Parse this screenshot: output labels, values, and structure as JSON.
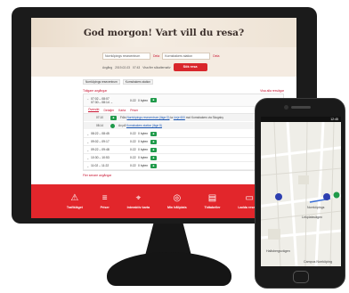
{
  "hero": {
    "title": "God morgon! Vart vill du resa?"
  },
  "search": {
    "from_value": "Norrköpings resecentrum",
    "from_tag": "Dela",
    "to_value": "Kornsbakers station",
    "to_tag": "Dela",
    "options": [
      "Avgång",
      "2019-02-03",
      "07:43",
      "Visa fler sökalternativ"
    ],
    "button": "Sök resa"
  },
  "results": {
    "crumbs": [
      "Norrköpings resecentrum",
      "Kornsbakers station"
    ],
    "earlier": "Tidigare avgångar",
    "show_all": "Visa alla resvägar",
    "open_trip": {
      "time1": "07:02 – 08:07",
      "time2": "07:30 – 08:14 →",
      "dur": "0:22",
      "chg": "0 byten",
      "mode": "bus"
    },
    "tabs": [
      "Översikt",
      "Detaljer",
      "Karta",
      "Priser"
    ],
    "details": [
      {
        "time": "07:10",
        "text1": "Från ",
        "link1": "Norrköpings resecentrum (läge D)",
        "text2": " ta ",
        "link2": "Linje 600",
        "text3": " mot Kornsbakers via Skogsby"
      },
      {
        "time": "08:14",
        "text1": "Av på ",
        "link1": "Kornsbakers station (läge 8)",
        "text2": "",
        "link2": "",
        "text3": ""
      }
    ],
    "trips": [
      {
        "time": "08:22 – 08:45",
        "dur": "0:22",
        "chg": "0 byten"
      },
      {
        "time": "09:02 – 09:17",
        "dur": "0:22",
        "chg": "0 byten"
      },
      {
        "time": "09:22 – 09:48",
        "dur": "0:22",
        "chg": "0 byten"
      },
      {
        "time": "10:30 – 10:53",
        "dur": "0:22",
        "chg": "0 byten"
      },
      {
        "time": "11:02 – 11:22",
        "dur": "0:22",
        "chg": "0 byten"
      }
    ],
    "later": "Fler senare avgångar"
  },
  "bottom_nav": [
    {
      "icon": "warning-icon",
      "glyph": "⚠",
      "label": "Trafikläget"
    },
    {
      "icon": "ticket-stack-icon",
      "glyph": "≡",
      "label": "Priser"
    },
    {
      "icon": "pin-icon",
      "glyph": "⌖",
      "label": "Interaktiv karta"
    },
    {
      "icon": "location-icon",
      "glyph": "◎",
      "label": "Min hållplats"
    },
    {
      "icon": "timetable-icon",
      "glyph": "▤",
      "label": "Tidtabeller"
    },
    {
      "icon": "card-icon",
      "glyph": "▭",
      "label": "Ladda resekort"
    }
  ],
  "phone": {
    "status": "12:45",
    "labels": [
      "Norrköpings",
      "Lekplatsvägen",
      "Hallsbergsvägen",
      "Campus Norrköping"
    ]
  },
  "colors": {
    "brand_red": "#e2262b",
    "bus_green": "#1f9a4a",
    "link_blue": "#1a57b5"
  }
}
